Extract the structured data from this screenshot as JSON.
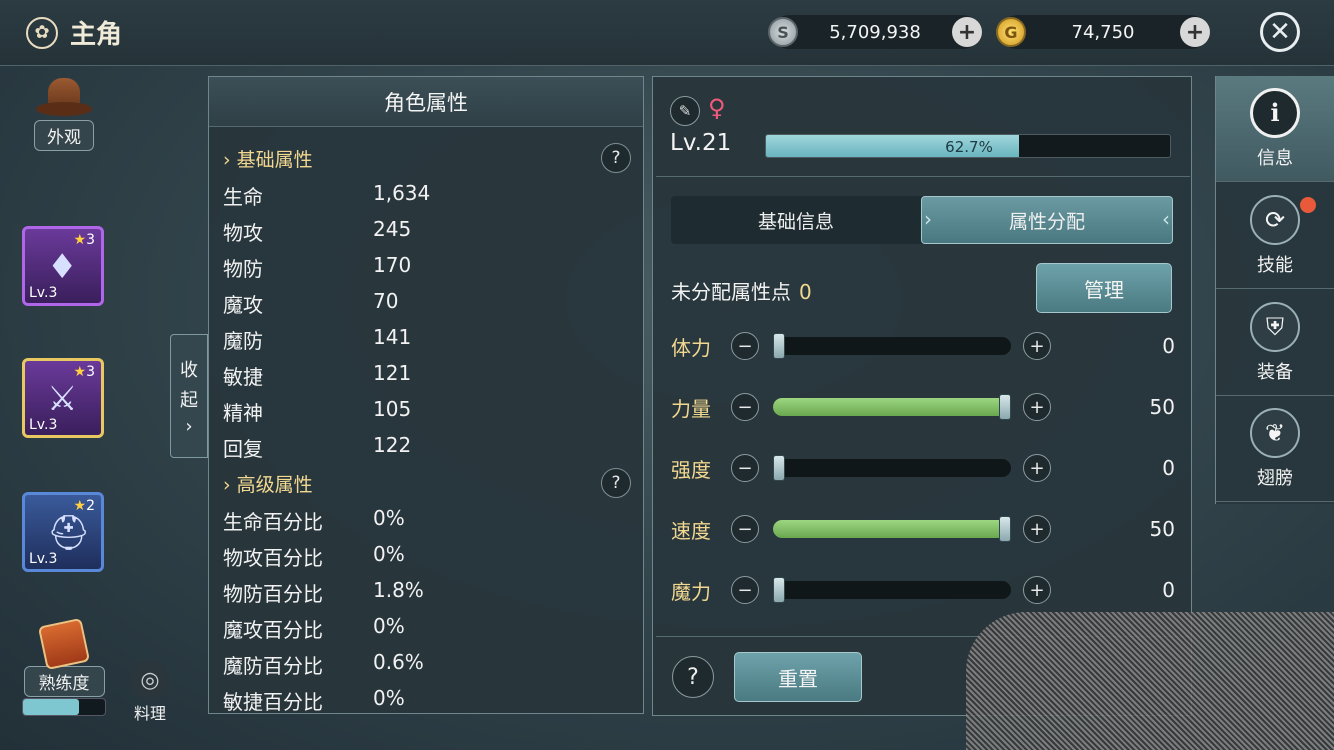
{
  "header": {
    "title": "主角",
    "title_icon": "flower-emblem-icon",
    "silver": "5,709,938",
    "gold": "74,750",
    "plus": "+",
    "close_icon": "close-icon"
  },
  "left": {
    "appearance_label": "外观",
    "equipment": [
      {
        "stars": "3",
        "level": "Lv.3",
        "rarity": "purple",
        "icon": "earring-icon"
      },
      {
        "stars": "3",
        "level": "Lv.3",
        "rarity": "gold",
        "icon": "axe-icon"
      },
      {
        "stars": "2",
        "level": "Lv.3",
        "rarity": "blue",
        "icon": "helmet-icon"
      }
    ],
    "proficiency_label": "熟练度",
    "proficiency_progress": 0.68,
    "cooking_label": "料理",
    "collapse_label_1": "收",
    "collapse_label_2": "起"
  },
  "attributes": {
    "title": "角色属性",
    "basic_title": "基础属性",
    "basic": [
      {
        "name": "生命",
        "value": "1,634"
      },
      {
        "name": "物攻",
        "value": "245"
      },
      {
        "name": "物防",
        "value": "170"
      },
      {
        "name": "魔攻",
        "value": "70"
      },
      {
        "name": "魔防",
        "value": "141"
      },
      {
        "name": "敏捷",
        "value": "121"
      },
      {
        "name": "精神",
        "value": "105"
      },
      {
        "name": "回复",
        "value": "122"
      }
    ],
    "advanced_title": "高级属性",
    "advanced": [
      {
        "name": "生命百分比",
        "value": "0%"
      },
      {
        "name": "物攻百分比",
        "value": "0%"
      },
      {
        "name": "物防百分比",
        "value": "1.8%"
      },
      {
        "name": "魔攻百分比",
        "value": "0%"
      },
      {
        "name": "魔防百分比",
        "value": "0.6%"
      },
      {
        "name": "敏捷百分比",
        "value": "0%"
      }
    ],
    "help": "?"
  },
  "info": {
    "level": "Lv.21",
    "exp_text": "62.7%",
    "exp_fraction": 0.627,
    "tabs": [
      "基础信息",
      "属性分配"
    ],
    "active_tab": 1,
    "unallocated_label": "未分配属性点",
    "unallocated_value": "0",
    "manage_label": "管理",
    "stats": [
      {
        "name": "体力",
        "value": "0",
        "fraction": 0
      },
      {
        "name": "力量",
        "value": "50",
        "fraction": 1
      },
      {
        "name": "强度",
        "value": "0",
        "fraction": 0
      },
      {
        "name": "速度",
        "value": "50",
        "fraction": 1
      },
      {
        "name": "魔力",
        "value": "0",
        "fraction": 0
      }
    ],
    "minus": "−",
    "plus": "+",
    "help": "?",
    "reset_label": "重置"
  },
  "nav": [
    {
      "label": "信息",
      "icon": "info-icon",
      "active": true
    },
    {
      "label": "技能",
      "icon": "skill-icon",
      "badge": true
    },
    {
      "label": "装备",
      "icon": "armor-icon"
    },
    {
      "label": "翅膀",
      "icon": "wing-icon"
    }
  ]
}
